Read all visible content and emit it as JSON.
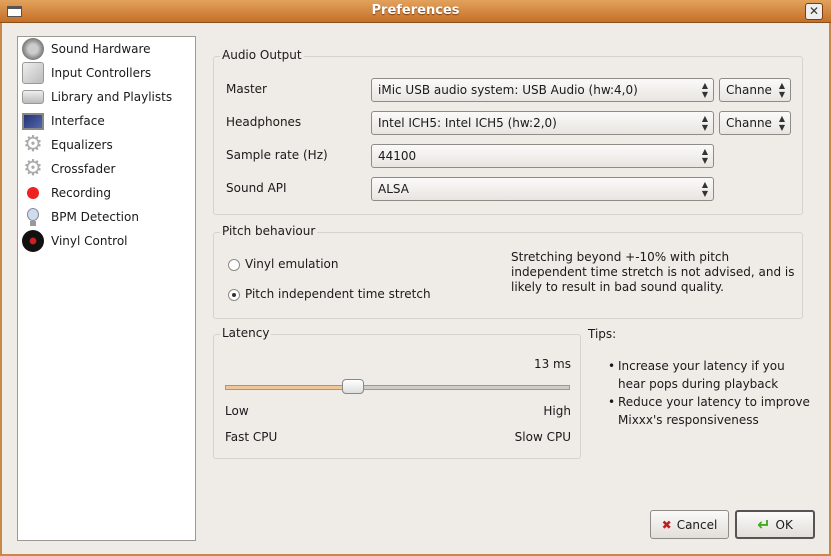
{
  "window": {
    "title": "Preferences",
    "close_label": "✕"
  },
  "sidebar": {
    "items": [
      {
        "label": "Sound Hardware",
        "icon": "speaker-icon"
      },
      {
        "label": "Input Controllers",
        "icon": "controller-icon"
      },
      {
        "label": "Library and Playlists",
        "icon": "drive-icon"
      },
      {
        "label": "Interface",
        "icon": "monitor-icon"
      },
      {
        "label": "Equalizers",
        "icon": "gear-icon"
      },
      {
        "label": "Crossfader",
        "icon": "gear-icon"
      },
      {
        "label": "Recording",
        "icon": "record-icon"
      },
      {
        "label": "BPM Detection",
        "icon": "bulb-icon"
      },
      {
        "label": "Vinyl Control",
        "icon": "vinyl-icon"
      }
    ]
  },
  "audio_output": {
    "title": "Audio Output",
    "master": {
      "label": "Master",
      "device": "iMic USB audio system: USB Audio (hw:4,0)",
      "channel": "Channe"
    },
    "headphones": {
      "label": "Headphones",
      "device": "Intel ICH5: Intel ICH5 (hw:2,0)",
      "channel": "Channe"
    },
    "sample_rate": {
      "label": "Sample rate (Hz)",
      "value": "44100"
    },
    "sound_api": {
      "label": "Sound API",
      "value": "ALSA"
    }
  },
  "pitch": {
    "title": "Pitch behaviour",
    "option_vinyl": "Vinyl emulation",
    "option_stretch": "Pitch independent time stretch",
    "selected": "stretch",
    "note": "Stretching beyond +-10% with pitch independent time stretch is not advised, and is likely to result in bad sound quality."
  },
  "latency": {
    "title": "Latency",
    "value_label": "13 ms",
    "slider_fraction": 0.37,
    "low": "Low",
    "high": "High",
    "fast": "Fast CPU",
    "slow": "Slow CPU"
  },
  "tips": {
    "title": "Tips:",
    "items": [
      "Increase your latency if you hear pops during playback",
      "Reduce your latency to improve Mixxx's responsiveness"
    ]
  },
  "buttons": {
    "cancel": "Cancel",
    "ok": "OK"
  },
  "colors": {
    "accent": "#e0a66e",
    "title": "#c56f27"
  }
}
